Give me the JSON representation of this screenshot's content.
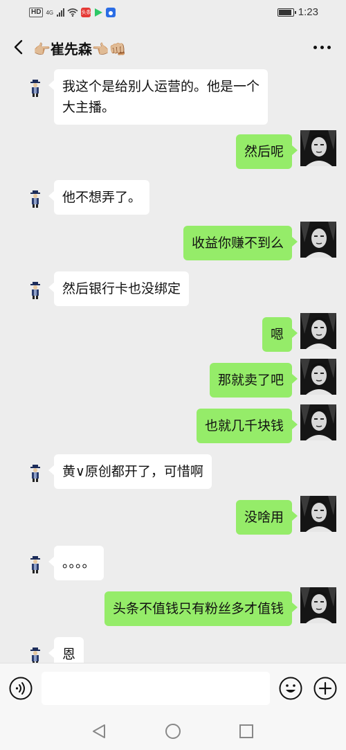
{
  "status_bar": {
    "left": {
      "hd": "HD",
      "network": "4G",
      "app_badge": "头条"
    },
    "time": "1:23",
    "battery_level": 0.85
  },
  "header": {
    "title_prefix_emoji": "👉🏼",
    "title_name": "崔先森",
    "title_suffix_emoji": "👈🏼👊🏼",
    "back_icon": "chevron-left-icon",
    "more_icon": "more-dots-icon"
  },
  "messages": [
    {
      "side": "in",
      "lines": [
        "我这个是给别人运营的。他是一个",
        "大主播。"
      ]
    },
    {
      "side": "out",
      "lines": [
        "然后呢"
      ]
    },
    {
      "side": "in",
      "lines": [
        "他不想弄了。"
      ]
    },
    {
      "side": "out",
      "lines": [
        "收益你赚不到么"
      ]
    },
    {
      "side": "in",
      "lines": [
        "然后银行卡也没绑定"
      ]
    },
    {
      "side": "out",
      "lines": [
        "嗯"
      ]
    },
    {
      "side": "out",
      "lines": [
        "那就卖了吧"
      ]
    },
    {
      "side": "out",
      "lines": [
        "也就几千块钱"
      ]
    },
    {
      "side": "in",
      "lines": [
        "黄∨原创都开了，可惜啊"
      ]
    },
    {
      "side": "out",
      "lines": [
        "没啥用"
      ]
    },
    {
      "side": "in",
      "lines": [
        "。。。。"
      ]
    },
    {
      "side": "out",
      "lines": [
        "头条不值钱只有粉丝多才值钱"
      ]
    },
    {
      "side": "in",
      "lines": [
        "恩"
      ]
    }
  ],
  "input_bar": {
    "voice_icon": "voice-icon",
    "input_value": "",
    "emoji_icon": "emoji-icon",
    "plus_icon": "plus-icon"
  },
  "nav_bar": {
    "back_icon": "nav-back-icon",
    "home_icon": "nav-home-icon",
    "recent_icon": "nav-recent-icon"
  },
  "colors": {
    "background": "#ededed",
    "outgoing_bubble": "#95ec69",
    "incoming_bubble": "#ffffff"
  }
}
